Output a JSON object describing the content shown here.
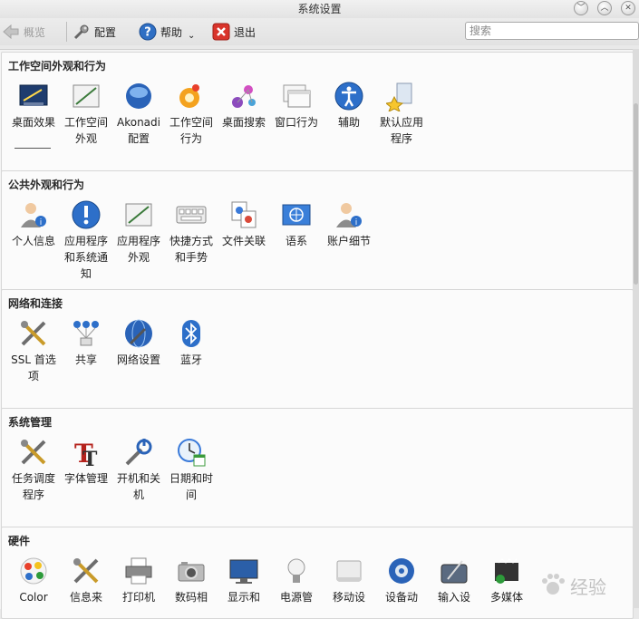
{
  "window": {
    "title": "系统设置"
  },
  "toolbar": {
    "back_label": "概览",
    "configure_label": "配置",
    "help_label": "帮助",
    "quit_label": "退出",
    "search_placeholder": "搜索"
  },
  "sections": [
    {
      "title": "工作空间外观和行为",
      "items": [
        {
          "label": "桌面效果",
          "icon": "desktop-effects-icon"
        },
        {
          "label": "工作空间外观",
          "icon": "workspace-appearance-icon"
        },
        {
          "label": "Akonadi配置",
          "icon": "akonadi-icon"
        },
        {
          "label": "工作空间行为",
          "icon": "workspace-behavior-icon"
        },
        {
          "label": "桌面搜索",
          "icon": "desktop-search-icon"
        },
        {
          "label": "窗口行为",
          "icon": "window-behavior-icon"
        },
        {
          "label": "辅助",
          "icon": "accessibility-icon"
        },
        {
          "label": "默认应用程序",
          "icon": "default-apps-icon"
        }
      ]
    },
    {
      "title": "公共外观和行为",
      "items": [
        {
          "label": "个人信息",
          "icon": "personal-info-icon"
        },
        {
          "label": "应用程序和系统通知",
          "icon": "notifications-icon"
        },
        {
          "label": "应用程序外观",
          "icon": "app-appearance-icon"
        },
        {
          "label": "快捷方式和手势",
          "icon": "shortcuts-icon"
        },
        {
          "label": "文件关联",
          "icon": "file-associations-icon"
        },
        {
          "label": "语系",
          "icon": "locale-icon"
        },
        {
          "label": "账户细节",
          "icon": "account-details-icon"
        }
      ]
    },
    {
      "title": "网络和连接",
      "items": [
        {
          "label": "SSL 首选项",
          "icon": "ssl-icon"
        },
        {
          "label": "共享",
          "icon": "sharing-icon"
        },
        {
          "label": "网络设置",
          "icon": "network-settings-icon"
        },
        {
          "label": "蓝牙",
          "icon": "bluetooth-icon"
        }
      ]
    },
    {
      "title": "系统管理",
      "items": [
        {
          "label": "任务调度程序",
          "icon": "task-scheduler-icon"
        },
        {
          "label": "字体管理",
          "icon": "font-manager-icon"
        },
        {
          "label": "开机和关机",
          "icon": "startup-shutdown-icon"
        },
        {
          "label": "日期和时间",
          "icon": "date-time-icon"
        }
      ]
    },
    {
      "title": "硬件",
      "items": [
        {
          "label": "Color",
          "icon": "color-icon"
        },
        {
          "label": "信息来",
          "icon": "info-sources-icon"
        },
        {
          "label": "打印机",
          "icon": "printer-icon"
        },
        {
          "label": "数码相",
          "icon": "camera-icon"
        },
        {
          "label": "显示和",
          "icon": "display-icon"
        },
        {
          "label": "电源管",
          "icon": "power-management-icon"
        },
        {
          "label": "移动设",
          "icon": "removable-devices-icon"
        },
        {
          "label": "设备动",
          "icon": "device-actions-icon"
        },
        {
          "label": "输入设",
          "icon": "input-devices-icon"
        },
        {
          "label": "多媒体",
          "icon": "multimedia-icon"
        }
      ]
    }
  ],
  "watermark": {
    "text": "经验"
  }
}
